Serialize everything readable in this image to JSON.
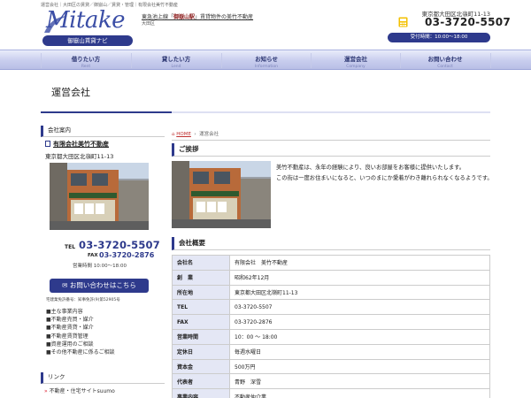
{
  "header": {
    "breadcrumb_top": "運営会社｜大田区の賃貸／御嶽山／賃貸・管理｜有限会社美竹不動産",
    "logo_text": "Mitake",
    "logo_badge": "御嶽山賃貸ナビ",
    "tagline_prefix": "東急池上線「",
    "tagline_station": "御嶽山駅",
    "tagline_suffix": "」賃貸物件の美竹不動産",
    "tagline_sub": "大田区",
    "address": "東京都大田区北嶺町11-13",
    "phone": "03-3720-5507",
    "hours": "受付時間：10:00～18:00"
  },
  "nav": [
    {
      "label": "借りたい方",
      "sub": "Rent"
    },
    {
      "label": "貸したい方",
      "sub": "Lend"
    },
    {
      "label": "お知らせ",
      "sub": "Information"
    },
    {
      "label": "運営会社",
      "sub": "Company"
    },
    {
      "label": "お問い合わせ",
      "sub": "Contact"
    }
  ],
  "page": {
    "title": "運営会社"
  },
  "sidebar": {
    "section_title": "会社案内",
    "company_name": "有限会社美竹不動産",
    "address": "東京都大田区北嶺町11-13",
    "tel_label": "TEL",
    "tel": "03-3720-5507",
    "fax_label": "FAX",
    "fax": "03-3720-2876",
    "hours": "営業時間 10:00～18:00",
    "contact_button": "お問い合わせはこちら",
    "license": "宅建業免許番号：知事免許(9)第52905号",
    "business_items": [
      "■主な事業内容",
      "■不動産売買・媒介",
      "■不動産賃貸・媒介",
      "■不動産賃貸管理",
      "■資産運用のご相談",
      "■その他不動産に係るご相談"
    ],
    "links_title": "リンク",
    "links": [
      "不動産・住宅サイトsuumo"
    ]
  },
  "breadcrumb": {
    "home": "HOME",
    "current": "運営会社"
  },
  "greeting": {
    "title": "ご挨拶",
    "lines": [
      "美竹不動産は、永年の経験により、良いお部屋をお客様に提供いたします。",
      "この街は一度お住まいになると、いつのまにか愛着がわき離れられなくなるようです。"
    ]
  },
  "overview": {
    "title": "会社概要",
    "rows": [
      {
        "k": "会社名",
        "v": "有限会社　美竹不動産"
      },
      {
        "k": "創　業",
        "v": "昭和62年12月"
      },
      {
        "k": "所在地",
        "v": "東京都大田区北嶺町11-13"
      },
      {
        "k": "TEL",
        "v": "03-3720-5507"
      },
      {
        "k": "FAX",
        "v": "03-3720-2876"
      },
      {
        "k": "営業時間",
        "v": "10：00 ～ 18:00"
      },
      {
        "k": "定休日",
        "v": "毎週水曜日"
      },
      {
        "k": "資本金",
        "v": "500万円"
      },
      {
        "k": "代表者",
        "v": "青野　深雪"
      },
      {
        "k": "事業内容",
        "v": "不動産仲介業"
      }
    ]
  },
  "colors": {
    "brand": "#2e3a8c",
    "accent_red": "#c03030",
    "nav_bg": "#c8cdee"
  }
}
